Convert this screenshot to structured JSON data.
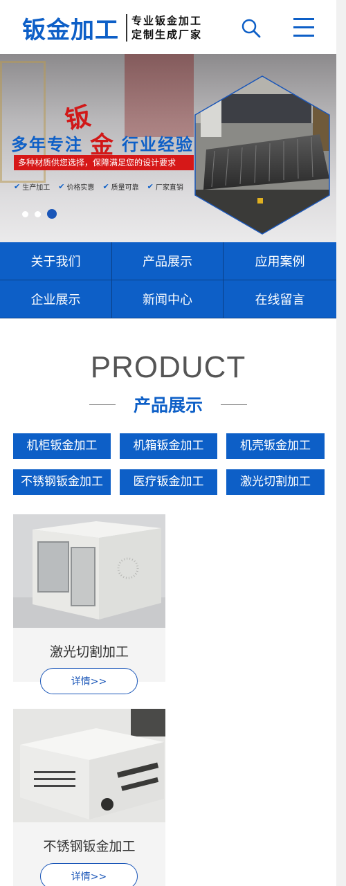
{
  "header": {
    "logo_main": "钣金加工",
    "logo_sub_1": "专业钣金加工",
    "logo_sub_2": "定制生成厂家"
  },
  "banner": {
    "big_char_top": "钣",
    "slogan_left": "多年专注",
    "slogan_mid": "金",
    "slogan_right": "行业经验",
    "red_bar": "多种材质供您选择，保障满足您的设计要求",
    "features": [
      "生产加工",
      "价格实惠",
      "质量可靠",
      "厂家直销"
    ],
    "slide_count": 3,
    "active_slide": 3
  },
  "nav": {
    "items": [
      "关于我们",
      "产品展示",
      "应用案例",
      "企业展示",
      "新闻中心",
      "在线留言"
    ]
  },
  "product": {
    "title_en": "PRODUCT",
    "title_cn": "产品展示",
    "categories": [
      "机柜钣金加工",
      "机箱钣金加工",
      "机壳钣金加工",
      "不锈钢钣金加工",
      "医疗钣金加工",
      "激光切割加工"
    ],
    "cards": [
      {
        "title": "激光切割加工",
        "button": "详情>>"
      },
      {
        "title": "不锈钢钣金加工",
        "button": "详情>>"
      }
    ]
  },
  "colors": {
    "brand_blue": "#0d5fc7",
    "accent_red": "#d61818"
  },
  "icons": {
    "search": "search-icon",
    "menu": "menu-icon"
  }
}
